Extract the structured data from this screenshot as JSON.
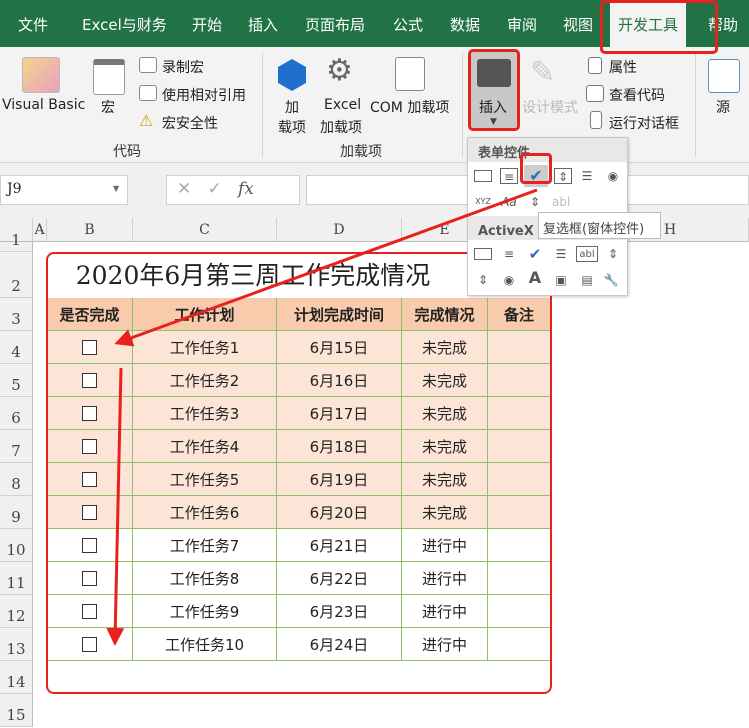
{
  "tabs": [
    "文件",
    "Excel与财务",
    "开始",
    "插入",
    "页面布局",
    "公式",
    "数据",
    "审阅",
    "视图",
    "开发工具",
    "帮助"
  ],
  "active_tab": "开发工具",
  "ribbon": {
    "code": {
      "visual_basic": "Visual Basic",
      "macros": "宏",
      "record_macro": "录制宏",
      "relative_ref": "使用相对引用",
      "macro_security": "宏安全性",
      "group": "代码"
    },
    "addins": {
      "addins_1": "加",
      "addins_2": "载项",
      "excel_addins_1": "Excel",
      "excel_addins_2": "加载项",
      "com_addins": "COM 加载项",
      "group": "加载项"
    },
    "controls": {
      "insert": "插入",
      "design_mode": "设计模式",
      "properties": "属性",
      "view_code": "查看代码",
      "run_dialog": "运行对话框"
    },
    "xml": {
      "source": "源"
    }
  },
  "formula_bar": {
    "name_box": "J9",
    "fx": "fx",
    "value": ""
  },
  "columns": [
    "A",
    "B",
    "C",
    "D",
    "E",
    "H"
  ],
  "rows": [
    "1",
    "2",
    "3",
    "4",
    "5",
    "6",
    "7",
    "8",
    "9",
    "10",
    "11",
    "12",
    "13",
    "14",
    "15"
  ],
  "sheet": {
    "title": "2020年6月第三周工作完成情况",
    "headers": [
      "是否完成",
      "工作计划",
      "计划完成时间",
      "完成情况",
      "备注"
    ],
    "rows": [
      {
        "checked": false,
        "task": "工作任务1",
        "date": "6月15日",
        "status": "未完成",
        "note": ""
      },
      {
        "checked": false,
        "task": "工作任务2",
        "date": "6月16日",
        "status": "未完成",
        "note": ""
      },
      {
        "checked": false,
        "task": "工作任务3",
        "date": "6月17日",
        "status": "未完成",
        "note": ""
      },
      {
        "checked": false,
        "task": "工作任务4",
        "date": "6月18日",
        "status": "未完成",
        "note": ""
      },
      {
        "checked": false,
        "task": "工作任务5",
        "date": "6月19日",
        "status": "未完成",
        "note": ""
      },
      {
        "checked": false,
        "task": "工作任务6",
        "date": "6月20日",
        "status": "未完成",
        "note": ""
      },
      {
        "checked": false,
        "task": "工作任务7",
        "date": "6月21日",
        "status": "进行中",
        "note": ""
      },
      {
        "checked": false,
        "task": "工作任务8",
        "date": "6月22日",
        "status": "进行中",
        "note": ""
      },
      {
        "checked": false,
        "task": "工作任务9",
        "date": "6月23日",
        "status": "进行中",
        "note": ""
      },
      {
        "checked": false,
        "task": "工作任务10",
        "date": "6月24日",
        "status": "进行中",
        "note": ""
      }
    ]
  },
  "dropdown": {
    "form_controls": "表单控件",
    "activex": "ActiveX 控件",
    "tooltip": "复选框(窗体控件)"
  },
  "colors": {
    "excel_green": "#217346",
    "header_fill": "#f8cbad",
    "pending_fill": "#fce4d6",
    "highlight_red": "#e8211d",
    "border_green": "#8fbf6a"
  }
}
